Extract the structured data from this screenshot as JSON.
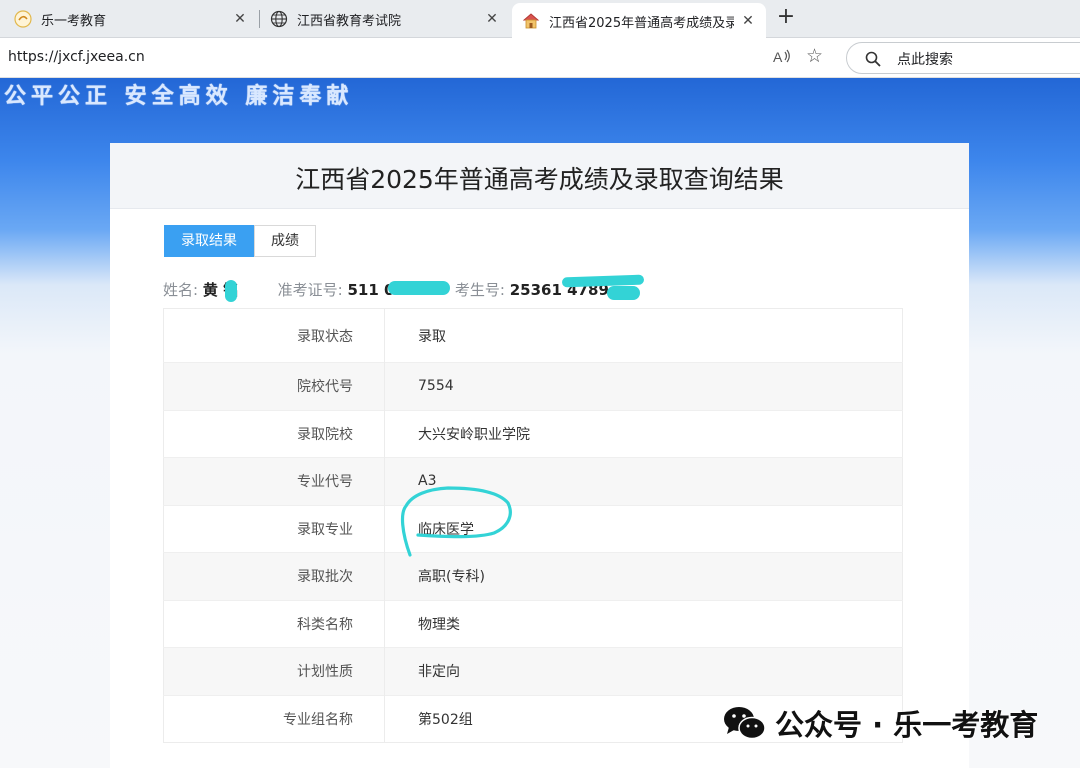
{
  "browser": {
    "tabs": [
      {
        "title": "乐一考教育",
        "close": "✕"
      },
      {
        "title": "江西省教育考试院",
        "close": "✕"
      },
      {
        "title": "江西省2025年普通高考成绩及录取",
        "close": "✕"
      }
    ],
    "new_tab": "+",
    "url": "https://jxcf.jxeea.cn",
    "read_aloud": "A͉",
    "favorite": "☆",
    "search_placeholder": "点此搜索"
  },
  "page": {
    "slogan": "公平公正 安全高效 廉洁奉献",
    "title": "江西省2025年普通高考成绩及录取查询结果",
    "tabs": [
      {
        "label": "录取结果",
        "active": true
      },
      {
        "label": "成绩",
        "active": false
      }
    ],
    "student": {
      "name_label": "姓名:",
      "name_value": "黄 铭",
      "exam_label": "准考证号:",
      "exam_value": "511 021",
      "candidate_label": "考生号:",
      "candidate_value": "25361 4789"
    },
    "results": [
      {
        "key": "录取状态",
        "value": "录取"
      },
      {
        "key": "院校代号",
        "value": "7554"
      },
      {
        "key": "录取院校",
        "value": "大兴安岭职业学院"
      },
      {
        "key": "专业代号",
        "value": "A3"
      },
      {
        "key": "录取专业",
        "value": "临床医学"
      },
      {
        "key": "录取批次",
        "value": "高职(专科)"
      },
      {
        "key": "科类名称",
        "value": "物理类"
      },
      {
        "key": "计划性质",
        "value": "非定向"
      },
      {
        "key": "专业组名称",
        "value": "第502组"
      }
    ]
  },
  "watermark": {
    "text": "公众号 · 乐一考教育"
  },
  "colors": {
    "accent": "#3aa0f2",
    "banner_blue": "#2367d6",
    "annotation_cyan": "#33d3d6"
  }
}
